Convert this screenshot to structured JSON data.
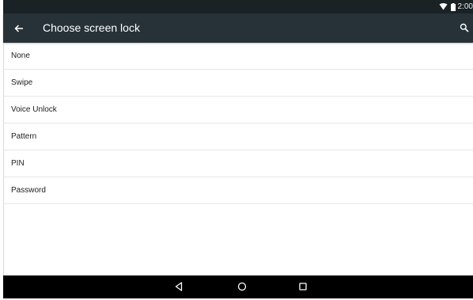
{
  "status_bar": {
    "time": "2:00",
    "icons": [
      "wifi-icon",
      "battery-icon"
    ]
  },
  "toolbar": {
    "title": "Choose screen lock",
    "back_icon": "arrow-left-icon",
    "search_icon": "search-icon"
  },
  "options": [
    {
      "label": "None"
    },
    {
      "label": "Swipe"
    },
    {
      "label": "Voice Unlock"
    },
    {
      "label": "Pattern"
    },
    {
      "label": "PIN"
    },
    {
      "label": "Password"
    }
  ],
  "nav_bar": {
    "buttons": [
      "back-triangle-icon",
      "home-circle-icon",
      "recents-square-icon"
    ]
  },
  "colors": {
    "toolbar": "#263238",
    "status_bar": "#1a2226",
    "nav_bar": "#000000",
    "divider": "#e6e6e6"
  }
}
